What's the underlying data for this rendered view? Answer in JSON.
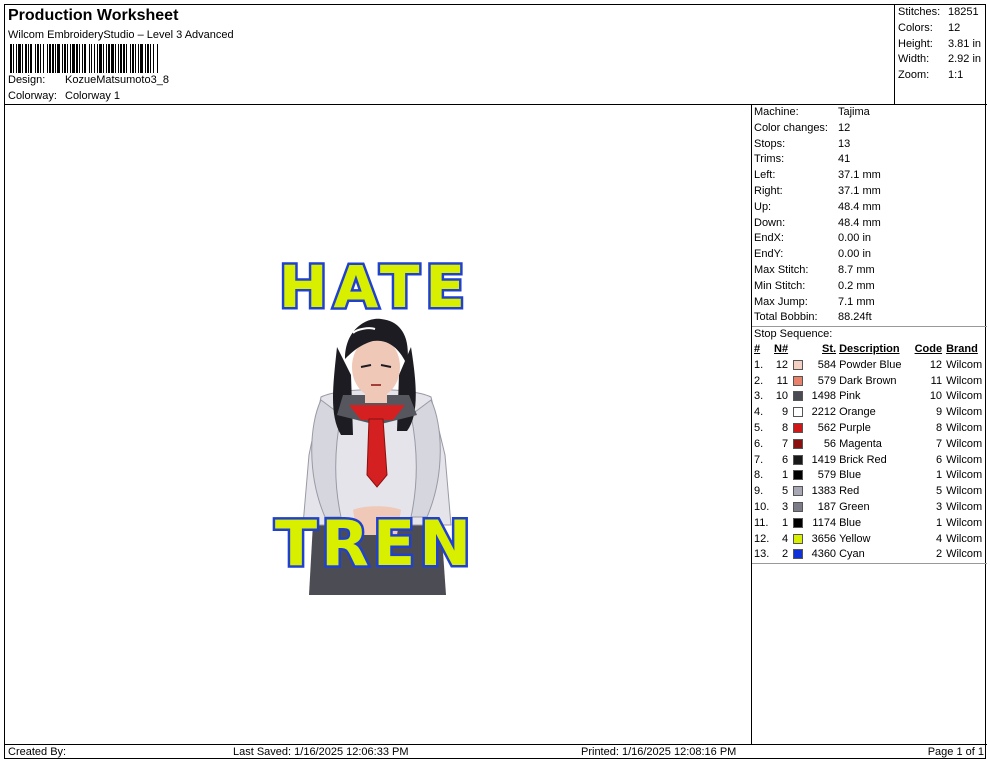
{
  "header": {
    "title": "Production Worksheet",
    "subtitle": "Wilcom EmbroideryStudio – Level 3 Advanced",
    "design_label": "Design:",
    "design_value": "KozueMatsumoto3_8",
    "colorway_label": "Colorway:",
    "colorway_value": "Colorway 1"
  },
  "summary": [
    {
      "label": "Stitches:",
      "value": "18251"
    },
    {
      "label": "Colors:",
      "value": "12"
    },
    {
      "label": "Height:",
      "value": "3.81 in"
    },
    {
      "label": "Width:",
      "value": "2.92 in"
    },
    {
      "label": "Zoom:",
      "value": "1:1"
    }
  ],
  "design": {
    "top_text": "HATE",
    "bottom_text": "TREN"
  },
  "info": [
    {
      "label": "Machine:",
      "value": "Tajima"
    },
    {
      "label": "Color changes:",
      "value": "12"
    },
    {
      "label": "Stops:",
      "value": "13"
    },
    {
      "label": "Trims:",
      "value": "41"
    },
    {
      "label": "Left:",
      "value": "37.1 mm"
    },
    {
      "label": "Right:",
      "value": "37.1 mm"
    },
    {
      "label": "Up:",
      "value": "48.4 mm"
    },
    {
      "label": "Down:",
      "value": "48.4 mm"
    },
    {
      "label": "EndX:",
      "value": "0.00 in"
    },
    {
      "label": "EndY:",
      "value": "0.00 in"
    },
    {
      "label": "Max Stitch:",
      "value": "8.7 mm"
    },
    {
      "label": "Min Stitch:",
      "value": "0.2 mm"
    },
    {
      "label": "Max Jump:",
      "value": "7.1 mm"
    },
    {
      "label": "Total Bobbin:",
      "value": "88.24ft"
    }
  ],
  "stop_sequence": {
    "label": "Stop Sequence:",
    "headers": [
      "#",
      "N#",
      "St.",
      "Description",
      "Code",
      "Brand"
    ],
    "rows": [
      {
        "idx": "1.",
        "n": "12",
        "color": "#f4d0c4",
        "st": "584",
        "desc": "Powder Blue",
        "code": "12",
        "brand": "Wilcom"
      },
      {
        "idx": "2.",
        "n": "11",
        "color": "#e8806a",
        "st": "579",
        "desc": "Dark Brown",
        "code": "11",
        "brand": "Wilcom"
      },
      {
        "idx": "3.",
        "n": "10",
        "color": "#4a4a52",
        "st": "1498",
        "desc": "Pink",
        "code": "10",
        "brand": "Wilcom"
      },
      {
        "idx": "4.",
        "n": "9",
        "color": "#ffffff",
        "st": "2212",
        "desc": "Orange",
        "code": "9",
        "brand": "Wilcom"
      },
      {
        "idx": "5.",
        "n": "8",
        "color": "#d01818",
        "st": "562",
        "desc": "Purple",
        "code": "8",
        "brand": "Wilcom"
      },
      {
        "idx": "6.",
        "n": "7",
        "color": "#8a1010",
        "st": "56",
        "desc": "Magenta",
        "code": "7",
        "brand": "Wilcom"
      },
      {
        "idx": "7.",
        "n": "6",
        "color": "#181818",
        "st": "1419",
        "desc": "Brick Red",
        "code": "6",
        "brand": "Wilcom"
      },
      {
        "idx": "8.",
        "n": "1",
        "color": "#000000",
        "st": "579",
        "desc": "Blue",
        "code": "1",
        "brand": "Wilcom"
      },
      {
        "idx": "9.",
        "n": "5",
        "color": "#a8a8b4",
        "st": "1383",
        "desc": "Red",
        "code": "5",
        "brand": "Wilcom"
      },
      {
        "idx": "10.",
        "n": "3",
        "color": "#7c7c88",
        "st": "187",
        "desc": "Green",
        "code": "3",
        "brand": "Wilcom"
      },
      {
        "idx": "11.",
        "n": "1",
        "color": "#000000",
        "st": "1174",
        "desc": "Blue",
        "code": "1",
        "brand": "Wilcom"
      },
      {
        "idx": "12.",
        "n": "4",
        "color": "#d8f000",
        "st": "3656",
        "desc": "Yellow",
        "code": "4",
        "brand": "Wilcom"
      },
      {
        "idx": "13.",
        "n": "2",
        "color": "#1030d8",
        "st": "4360",
        "desc": "Cyan",
        "code": "2",
        "brand": "Wilcom"
      }
    ]
  },
  "footer": {
    "created_by": "Created By:",
    "last_saved": "Last Saved: 1/16/2025 12:06:33 PM",
    "printed": "Printed: 1/16/2025 12:08:16 PM",
    "page": "Page 1 of 1"
  }
}
